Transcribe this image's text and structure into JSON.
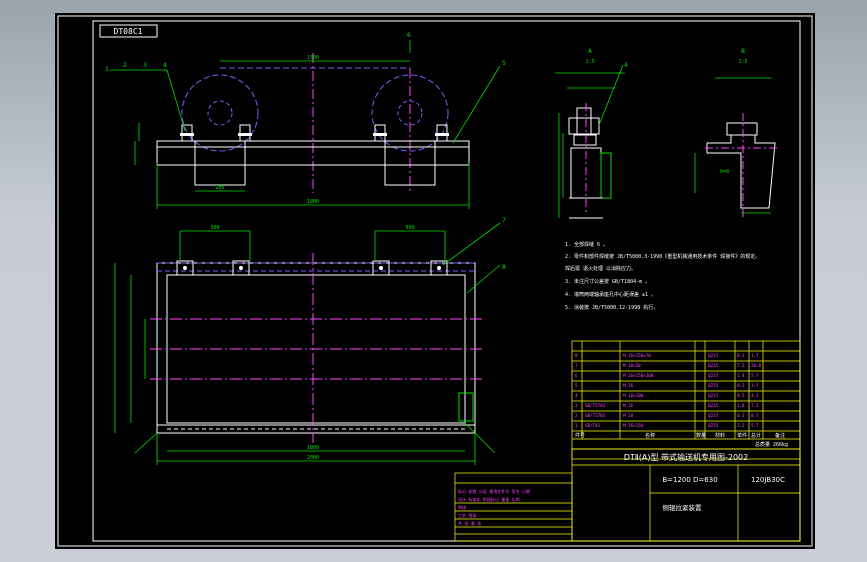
{
  "drawing": {
    "tag_number": "DT08C1",
    "header_title": "DTⅡ(A)型 带式输送机专用图-2002",
    "spec_label": "B=1200 D=630",
    "drawing_code": "120JB30C",
    "part_name": "侧辊拉紧装置",
    "view_a_label": "A",
    "view_b_label": "B",
    "scale_label": "1:5",
    "weight_label": "总质量 266kg",
    "parts_header": [
      "件号",
      "名称",
      "数量",
      "材料",
      "单件",
      "总计",
      "备注"
    ],
    "notes": [
      "1. 全部焊缝 6 。",
      "2. 零件和部件焊缝按 JB/T5000.3-1998《重型机械通用技术条件 焊接件》的规定。",
      "   焊后需 退火处理 以消除应力。",
      "3. 未注尺寸公差按 GB/T1804-m 。",
      "4. 滚筒两端轴承座孔中心距误差 ±1 。",
      "5. 涂装按 JB/T5000.12-1998 执行。"
    ],
    "callouts": [
      "1",
      "2",
      "3",
      "4",
      "5",
      "6",
      "7",
      "8"
    ]
  }
}
